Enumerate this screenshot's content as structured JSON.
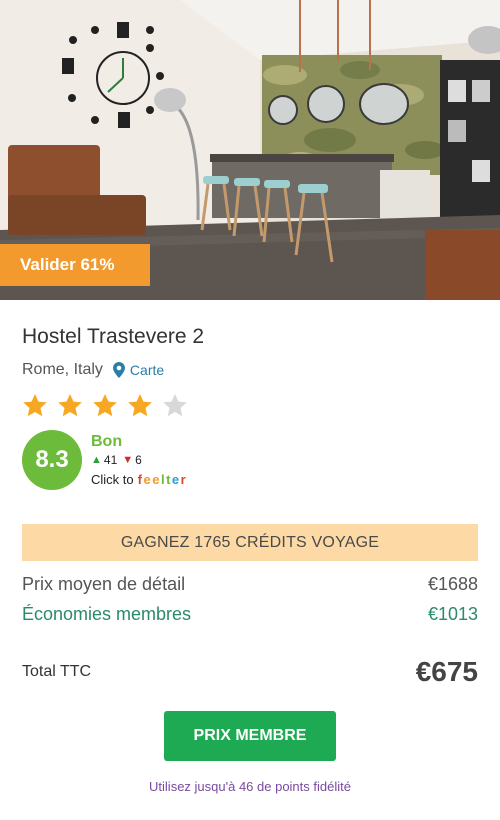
{
  "hero": {
    "badge_text": "Valider 61%",
    "badge_color": "#f29a2e"
  },
  "hotel": {
    "name": "Hostel Trastevere 2",
    "location": "Rome, Italy",
    "map_link": "Carte",
    "star_rating": 4,
    "star_max": 5
  },
  "rating": {
    "score": "8.3",
    "label": "Bon",
    "up_votes": "41",
    "down_votes": "6",
    "click_to": "Click to",
    "brand_letters": [
      "f",
      "e",
      "e",
      "l",
      "t",
      "e",
      "r"
    ]
  },
  "credits": {
    "banner_text": "GAGNEZ 1765 CRÉDITS VOYAGE"
  },
  "pricing": {
    "retail_label": "Prix moyen de détail",
    "retail_value": "€1688",
    "savings_label": "Économies membres",
    "savings_value": "€1013",
    "total_label": "Total TTC",
    "total_value": "€675"
  },
  "cta": {
    "button_label": "PRIX MEMBRE",
    "points_note": "Utilisez jusqu'à 46 de points fidélité"
  },
  "colors": {
    "accent_green": "#1eaa52",
    "score_green": "#6dbb3b",
    "star_gold": "#f7a823",
    "star_empty": "#d8d8d8",
    "banner_peach": "#fdd9a6"
  },
  "icons": {
    "location": "map-pin-icon",
    "star": "star-icon",
    "vote_up": "triangle-up-icon",
    "vote_down": "triangle-down-icon"
  }
}
